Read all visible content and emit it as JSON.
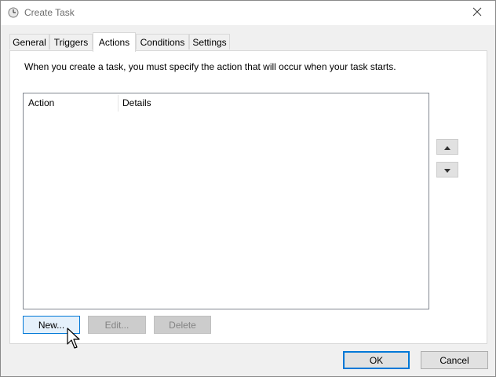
{
  "window": {
    "title": "Create Task",
    "icon": "clock-icon",
    "close_icon": "close-icon"
  },
  "tabs": [
    {
      "label": "General",
      "active": false
    },
    {
      "label": "Triggers",
      "active": false
    },
    {
      "label": "Actions",
      "active": true
    },
    {
      "label": "Conditions",
      "active": false
    },
    {
      "label": "Settings",
      "active": false
    }
  ],
  "actions_panel": {
    "description": "When you create a task, you must specify the action that will occur when your task starts.",
    "columns": [
      "Action",
      "Details"
    ],
    "rows": [],
    "move_up_icon": "triangle-up-icon",
    "move_down_icon": "triangle-down-icon",
    "buttons": {
      "new": "New...",
      "edit": "Edit...",
      "delete": "Delete"
    }
  },
  "footer": {
    "ok": "OK",
    "cancel": "Cancel"
  },
  "colors": {
    "accent": "#0078d7",
    "window_bg": "#f0f0f0",
    "panel_bg": "#ffffff",
    "disabled_button": "#cccccc"
  }
}
